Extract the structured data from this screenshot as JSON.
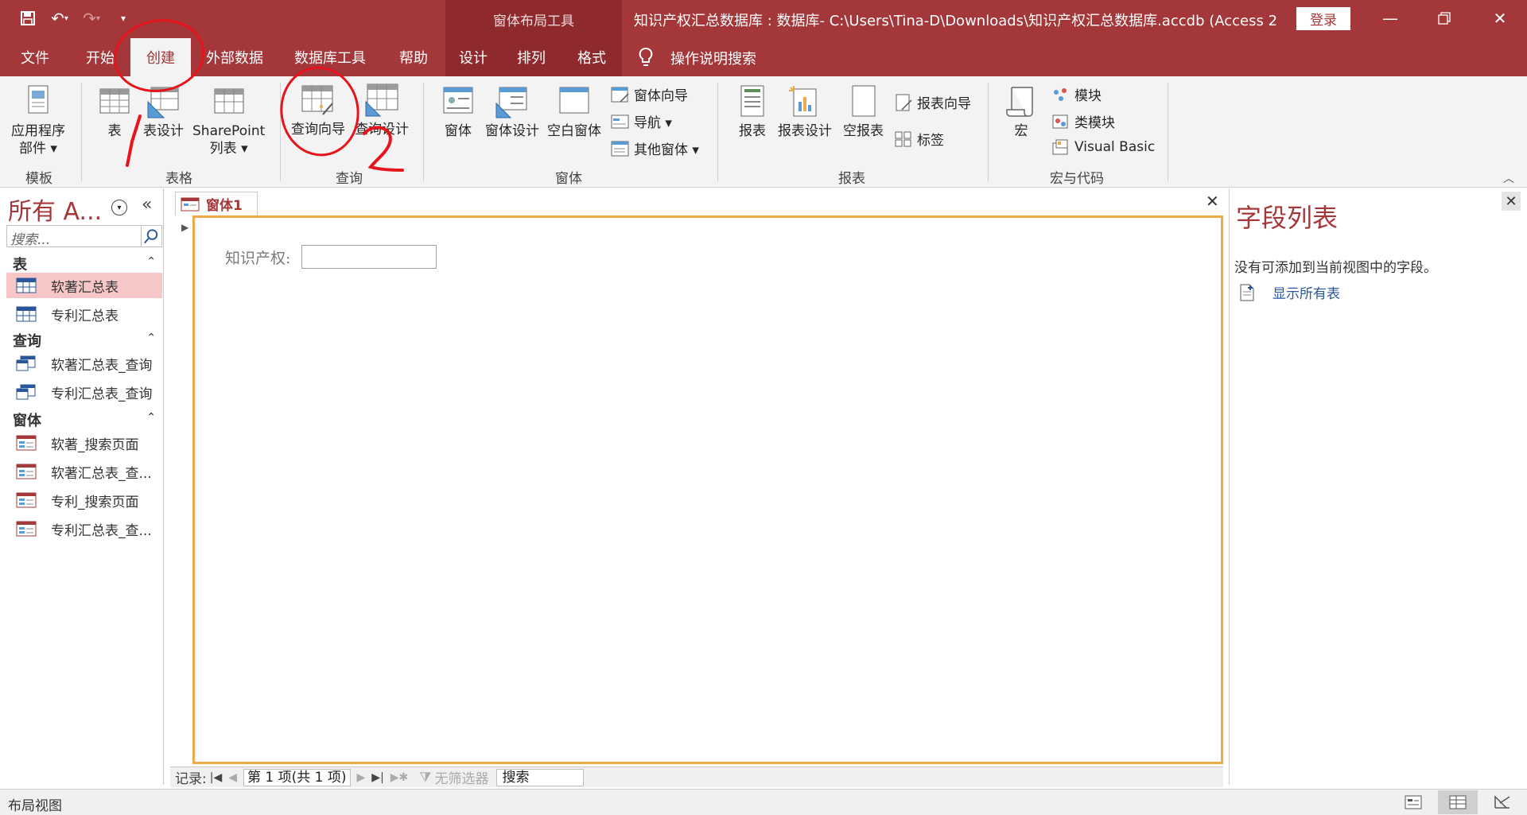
{
  "titlebar": {
    "context_tools": "窗体布局工具",
    "title": "知识产权汇总数据库 : 数据库- C:\\Users\\Tina-D\\Downloads\\知识产权汇总数据库.accdb (Access 2...",
    "login": "登录"
  },
  "tabs": {
    "file": "文件",
    "home": "开始",
    "create": "创建",
    "external": "外部数据",
    "dbtools": "数据库工具",
    "help": "帮助",
    "design": "设计",
    "arrange": "排列",
    "format": "格式",
    "tell_me": "操作说明搜索"
  },
  "ribbon": {
    "templates": {
      "label": "模板",
      "app_parts": "应用程序\n部件 ▾"
    },
    "tables": {
      "label": "表格",
      "table": "表",
      "table_design": "表设计",
      "sharepoint": "SharePoint\n列表 ▾"
    },
    "queries": {
      "label": "查询",
      "query_wizard": "查询向导",
      "query_design": "查询设计"
    },
    "forms": {
      "label": "窗体",
      "form": "窗体",
      "form_design": "窗体设计",
      "blank_form": "空白窗体",
      "form_wizard": "窗体向导",
      "navigation": "导航 ▾",
      "more_forms": "其他窗体 ▾"
    },
    "reports": {
      "label": "报表",
      "report": "报表",
      "report_design": "报表设计",
      "blank_report": "空报表",
      "report_wizard": "报表向导",
      "labels": "标签"
    },
    "macros": {
      "label": "宏与代码",
      "macro": "宏",
      "module": "模块",
      "class_module": "类模块",
      "visual_basic": "Visual Basic"
    }
  },
  "nav": {
    "title": "所有 A...",
    "search_placeholder": "搜索...",
    "sections": [
      {
        "name": "表",
        "items": [
          "软著汇总表",
          "专利汇总表"
        ]
      },
      {
        "name": "查询",
        "items": [
          "软著汇总表_查询",
          "专利汇总表_查询"
        ]
      },
      {
        "name": "窗体",
        "items": [
          "软著_搜索页面",
          "软著汇总表_查...",
          "专利_搜索页面",
          "专利汇总表_查..."
        ]
      }
    ]
  },
  "document": {
    "tab_label": "窗体1",
    "field_label": "知识产权:",
    "record_nav": {
      "prefix": "记录:",
      "position": "第 1 项(共 1 项)",
      "filter": "无筛选器",
      "search": "搜索"
    }
  },
  "field_list": {
    "title": "字段列表",
    "message": "没有可添加到当前视图中的字段。",
    "show_all": "显示所有表"
  },
  "status": {
    "text": "布局视图"
  },
  "colors": {
    "accent": "#a4373a",
    "annotation": "#e8141c",
    "form_border": "#f0a848"
  }
}
